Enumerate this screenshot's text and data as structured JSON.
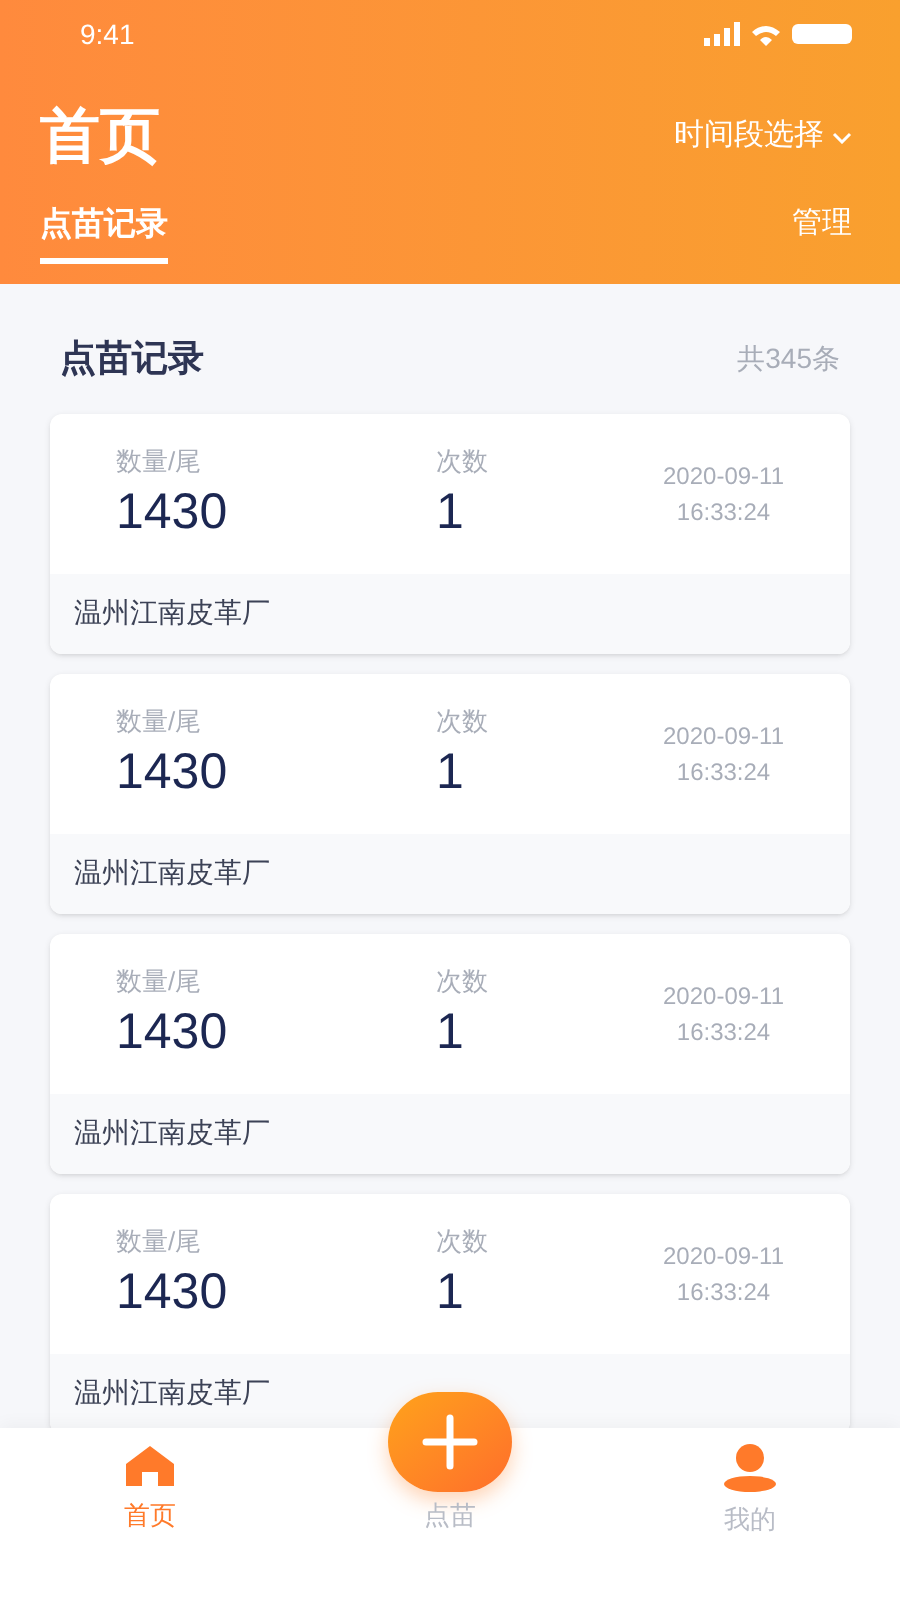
{
  "status_bar": {
    "time": "9:41"
  },
  "header": {
    "title": "首页",
    "filter": "时间段选择",
    "tabs": [
      {
        "label": "点苗记录",
        "selected": true
      }
    ],
    "action": "管理"
  },
  "section": {
    "title": "点苗记录",
    "count": "共345条"
  },
  "records": [
    {
      "quantity_label": "数量/尾",
      "quantity": "1430",
      "times_label": "次数",
      "times": "1",
      "date": "2020-09-11",
      "time": "16:33:24",
      "company": "温州江南皮革厂"
    },
    {
      "quantity_label": "数量/尾",
      "quantity": "1430",
      "times_label": "次数",
      "times": "1",
      "date": "2020-09-11",
      "time": "16:33:24",
      "company": "温州江南皮革厂"
    },
    {
      "quantity_label": "数量/尾",
      "quantity": "1430",
      "times_label": "次数",
      "times": "1",
      "date": "2020-09-11",
      "time": "16:33:24",
      "company": "温州江南皮革厂"
    },
    {
      "quantity_label": "数量/尾",
      "quantity": "1430",
      "times_label": "次数",
      "times": "1",
      "date": "2020-09-11",
      "time": "16:33:24",
      "company": "温州江南皮革厂"
    }
  ],
  "nav": [
    {
      "kind": "home",
      "label": "首页",
      "selected": true
    },
    {
      "kind": "add",
      "label": "点苗",
      "selected": false
    },
    {
      "kind": "profile",
      "label": "我的",
      "selected": false
    }
  ]
}
